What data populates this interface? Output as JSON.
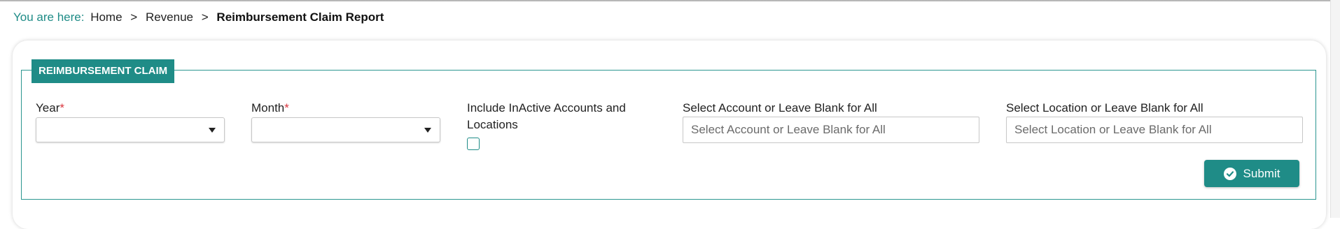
{
  "breadcrumb": {
    "prefix": "You are here:",
    "items": [
      "Home",
      "Revenue"
    ],
    "separator": ">",
    "current": "Reimbursement Claim Report"
  },
  "form": {
    "legend": "REIMBURSEMENT CLAIM",
    "year": {
      "label": "Year",
      "required_mark": "*",
      "value": ""
    },
    "month": {
      "label": "Month",
      "required_mark": "*",
      "value": ""
    },
    "include_inactive": {
      "label_line1": "Include InActive Accounts and",
      "label_line2": "Locations",
      "checked": false
    },
    "account": {
      "label": "Select Account or Leave Blank for All",
      "placeholder": "Select Account or Leave Blank for All",
      "value": ""
    },
    "location": {
      "label": "Select Location or Leave Blank for All",
      "placeholder": "Select Location or Leave Blank for All",
      "value": ""
    },
    "submit_label": "Submit"
  },
  "icons": {
    "submit": "check-circle-icon",
    "dropdown": "caret-down-icon"
  },
  "colors": {
    "accent": "#1f8c87",
    "required": "#d9363e",
    "border": "#c7c7c7"
  }
}
